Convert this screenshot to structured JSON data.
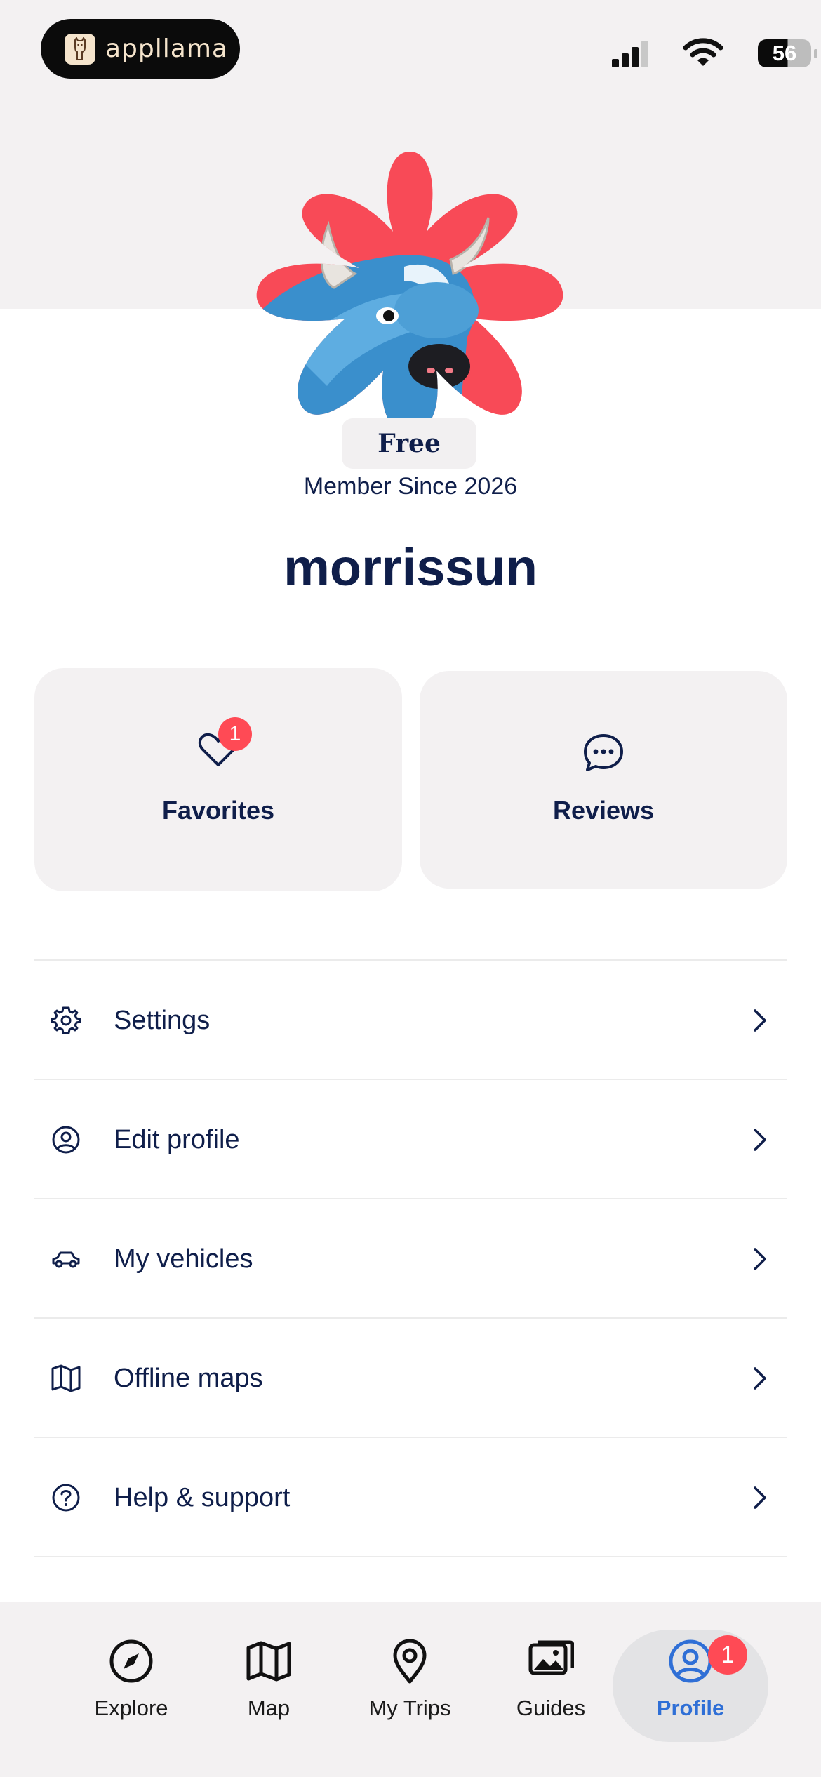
{
  "status_bar": {
    "app_badge": "appllama",
    "battery": "56"
  },
  "profile": {
    "plan": "Free",
    "member_since": "Member Since 2026",
    "username": "morrissun"
  },
  "cards": {
    "favorites": {
      "label": "Favorites",
      "badge": "1"
    },
    "reviews": {
      "label": "Reviews"
    }
  },
  "menu": {
    "items": [
      {
        "label": "Settings",
        "icon": "gear-icon"
      },
      {
        "label": "Edit profile",
        "icon": "user-circle-icon"
      },
      {
        "label": "My vehicles",
        "icon": "car-icon"
      },
      {
        "label": "Offline maps",
        "icon": "map-icon"
      },
      {
        "label": "Help & support",
        "icon": "question-circle-icon"
      }
    ]
  },
  "tabbar": {
    "tabs": [
      {
        "label": "Explore",
        "icon": "compass-icon"
      },
      {
        "label": "Map",
        "icon": "map-icon"
      },
      {
        "label": "My Trips",
        "icon": "pin-icon"
      },
      {
        "label": "Guides",
        "icon": "photos-icon"
      },
      {
        "label": "Profile",
        "icon": "user-circle-icon",
        "active": true,
        "badge": "1"
      }
    ]
  },
  "colors": {
    "navy": "#0f1e4a",
    "accent_red": "#ff4a55",
    "active_blue": "#2f6fd6",
    "card_bg": "#f3f1f2"
  }
}
